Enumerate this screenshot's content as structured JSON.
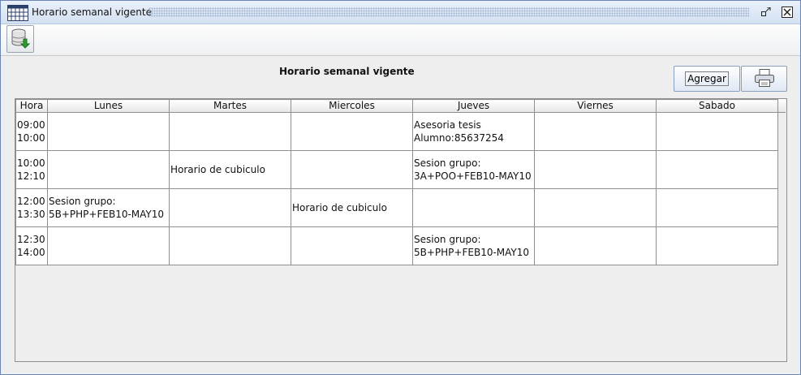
{
  "window": {
    "title": "Horario semanal vigente"
  },
  "toolbar": {
    "export_icon": "database-download-icon"
  },
  "panel": {
    "title": "Horario semanal vigente",
    "agregar_label": "Agregar",
    "print_icon": "printer-icon"
  },
  "table": {
    "columns": [
      "Hora",
      "Lunes",
      "Martes",
      "Miercoles",
      "Jueves",
      "Viernes",
      "Sabado"
    ],
    "rows": [
      [
        "09:00\n10:00",
        "",
        "",
        "",
        "Asesoria tesis\nAlumno:85637254",
        "",
        ""
      ],
      [
        "10:00\n12:10",
        "",
        "Horario de cubiculo",
        "",
        "Sesion grupo:\n3A+POO+FEB10-MAY10",
        "",
        ""
      ],
      [
        "12:00\n13:30",
        "Sesion grupo:\n5B+PHP+FEB10-MAY10",
        "",
        "Horario de cubiculo",
        "",
        "",
        ""
      ],
      [
        "12:30\n14:00",
        "",
        "",
        "",
        "Sesion grupo:\n5B+PHP+FEB10-MAY10",
        "",
        ""
      ]
    ]
  },
  "colors": {
    "titlebar_top": "#e9f0fa",
    "titlebar_bottom": "#d4e1f2",
    "frame_border": "#6b86b5",
    "grid": "#8f8f8f"
  }
}
